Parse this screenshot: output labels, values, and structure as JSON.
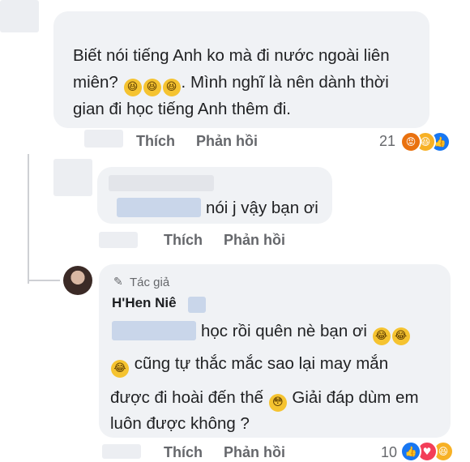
{
  "comment1": {
    "lines": [
      "Biết nói tiếng Anh ko mà đi nước ngoài liên",
      "miên?",
      ". Mình nghĩ là nên dành thời",
      "gian đi học tiếng Anh thêm đi."
    ],
    "actions": {
      "like": "Thích",
      "reply": "Phản hồi"
    },
    "reaction_count": "21",
    "reactions": [
      "angry",
      "haha",
      "like"
    ]
  },
  "comment2": {
    "text": "nói j vậy bạn ơi",
    "actions": {
      "like": "Thích",
      "reply": "Phản hồi"
    }
  },
  "comment3": {
    "author_tag": "Tác giả",
    "author_name": "H'Hen Niê",
    "lines": [
      "học rồi quên nè bạn ơi",
      "cũng tự thắc mắc sao lại may mắn",
      "được đi hoài đến thế",
      "Giải đáp dùm em",
      "luôn được không ?"
    ],
    "actions": {
      "like": "Thích",
      "reply": "Phản hồi"
    },
    "reaction_count": "10",
    "reactions": [
      "like",
      "love",
      "haha"
    ]
  },
  "colors": {
    "bubble": "#f0f2f5",
    "action_text": "#65676b",
    "like_blue": "#1877f2",
    "love_red": "#f33e58",
    "angry_orange": "#e9710f",
    "haha_yellow": "#f7b125"
  },
  "icons": [
    "pencil-icon",
    "laughing-emoji",
    "crying-laughing-emoji",
    "flushed-emoji"
  ]
}
